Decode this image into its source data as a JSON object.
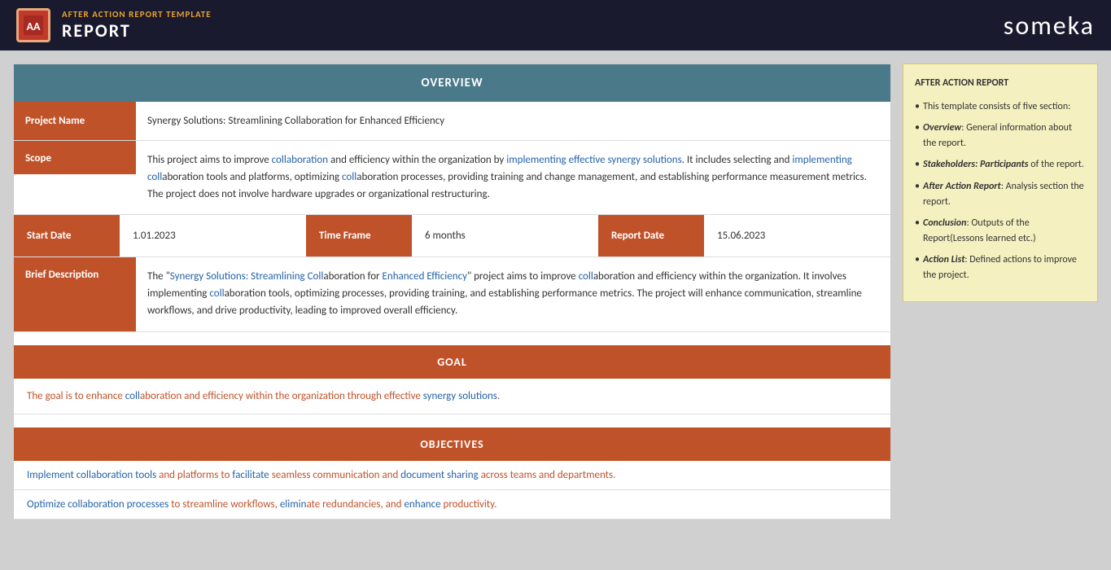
{
  "header": {
    "logo_text": "AA",
    "subtitle": "AFTER ACTION REPORT TEMPLATE",
    "title": "REPORT",
    "brand_prefix": "s",
    "brand_highlight": "ö",
    "brand_suffix": "meka"
  },
  "overview": {
    "section_label": "OVERVIEW",
    "project_name_label": "Project Name",
    "project_name_value": "Synergy Solutions: Streamlining Collaboration for Enhanced Efficiency",
    "scope_label": "Scope",
    "scope_value": "This project aims to improve collaboration and efficiency within the organization by implementing effective synergy solutions. It includes selecting and implementing collaboration tools and platforms, optimizing collaboration processes, providing training and change management, and establishing performance measurement metrics. The project does not involve hardware upgrades or organizational restructuring.",
    "start_date_label": "Start Date",
    "start_date_value": "1.01.2023",
    "time_frame_label": "Time Frame",
    "time_frame_value": "6 months",
    "report_date_label": "Report Date",
    "report_date_value": "15.06.2023",
    "brief_desc_label": "Brief Description",
    "brief_desc_value": "The \"Synergy Solutions: Streamlining Collaboration for Enhanced Efficiency\" project aims to improve collaboration and efficiency within the organization. It involves implementing collaboration tools, optimizing processes, providing training, and establishing performance metrics. The project will enhance communication, streamline workflows, and drive productivity, leading to improved overall efficiency."
  },
  "goal": {
    "section_label": "GOAL",
    "goal_text": "The goal is to enhance collaboration and efficiency within the organization through effective synergy solutions."
  },
  "objectives": {
    "section_label": "OBJECTIVES",
    "items": [
      "Implement collaboration tools and platforms to facilitate seamless communication and document sharing across teams and departments.",
      "Optimize collaboration processes to streamline workflows, eliminate redundancies, and enhance productivity."
    ]
  },
  "sidebar": {
    "title": "AFTER ACTION REPORT",
    "items": [
      {
        "text": "This template consists of five section:"
      },
      {
        "bold": "Overview",
        "text": ": General information about the report."
      },
      {
        "bold": "Stakeholders: Participants",
        "text": " of the report."
      },
      {
        "bold": "After Action Report",
        "text": ": Analysis section the report."
      },
      {
        "bold": "Conclusion",
        "text": ": Outputs of the Report(Lessons learned etc.)"
      },
      {
        "bold": "Action List",
        "text": ": Defined actions to improve the project."
      }
    ]
  }
}
